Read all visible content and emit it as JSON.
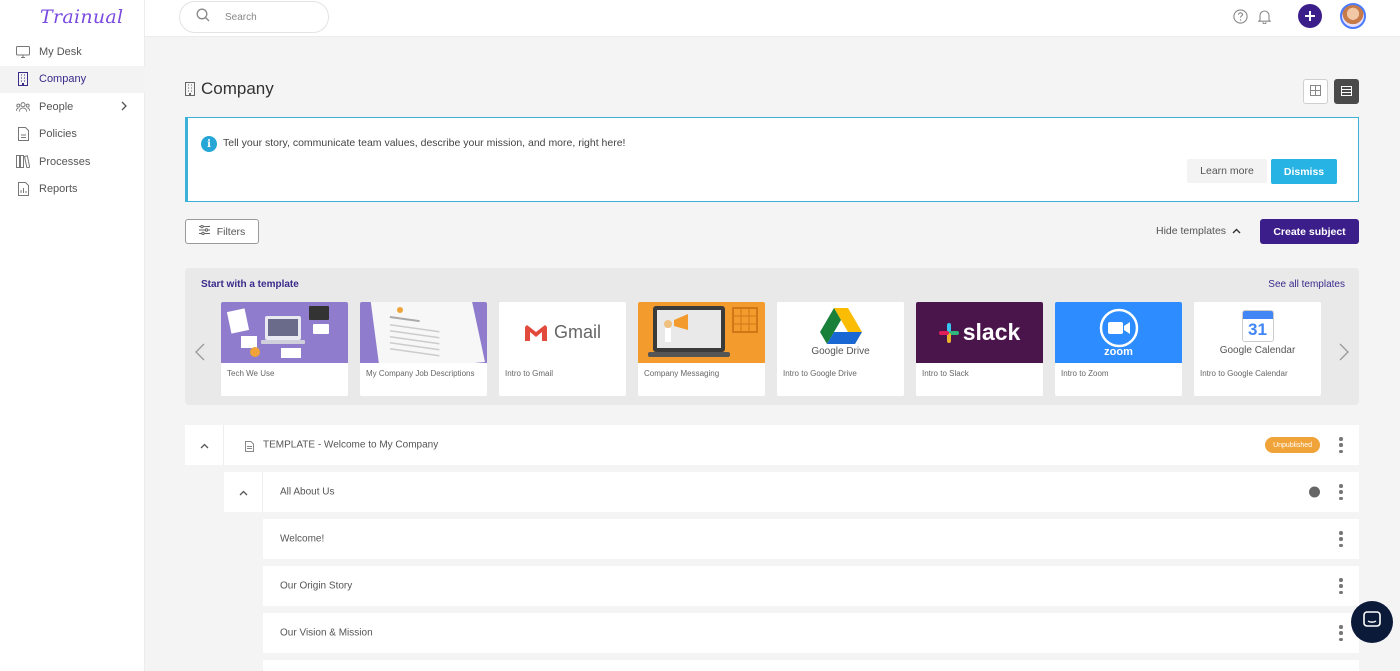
{
  "app": {
    "logo": "Trainual"
  },
  "sidebar": {
    "items": [
      {
        "label": "My Desk",
        "icon": "monitor-icon",
        "active": false
      },
      {
        "label": "Company",
        "icon": "building-icon",
        "active": true
      },
      {
        "label": "People",
        "icon": "people-icon",
        "active": false,
        "has_children": true
      },
      {
        "label": "Policies",
        "icon": "document-icon",
        "active": false
      },
      {
        "label": "Processes",
        "icon": "books-icon",
        "active": false
      },
      {
        "label": "Reports",
        "icon": "report-icon",
        "active": false
      }
    ]
  },
  "topbar": {
    "search_placeholder": "Search",
    "icons": [
      "help-icon",
      "bell-icon",
      "plus-icon",
      "avatar"
    ]
  },
  "page": {
    "title": "Company",
    "title_icon": "building-icon"
  },
  "banner": {
    "message": "Tell your story, communicate team values, describe your mission, and more, right here!",
    "learn_more": "Learn more",
    "dismiss": "Dismiss"
  },
  "toolbar": {
    "filters": "Filters",
    "hide_templates": "Hide templates",
    "create_subject": "Create subject"
  },
  "templates": {
    "heading": "Start with a template",
    "see_all": "See all templates",
    "cards": [
      {
        "label": "Tech We Use"
      },
      {
        "label": "My Company Job Descriptions"
      },
      {
        "label": "Intro to Gmail",
        "thumb_text": "Gmail"
      },
      {
        "label": "Company Messaging"
      },
      {
        "label": "Intro to Google Drive",
        "thumb_text": "Google Drive"
      },
      {
        "label": "Intro to Slack",
        "thumb_text": "slack"
      },
      {
        "label": "Intro to Zoom",
        "thumb_text": "zoom"
      },
      {
        "label": "Intro to Google Calendar",
        "thumb_text": "Google Calendar",
        "thumb_number": "31"
      }
    ]
  },
  "list": {
    "subject": {
      "title": "TEMPLATE - Welcome to My Company",
      "status": "Unpublished"
    },
    "topic": {
      "title": "All About Us"
    },
    "steps": [
      "Welcome!",
      "Our Origin Story",
      "Our Vision & Mission"
    ]
  },
  "colors": {
    "brand": "#3c1e8a",
    "accent": "#27b3e3",
    "badge": "#f0a338",
    "logo": "#7b4be0"
  }
}
